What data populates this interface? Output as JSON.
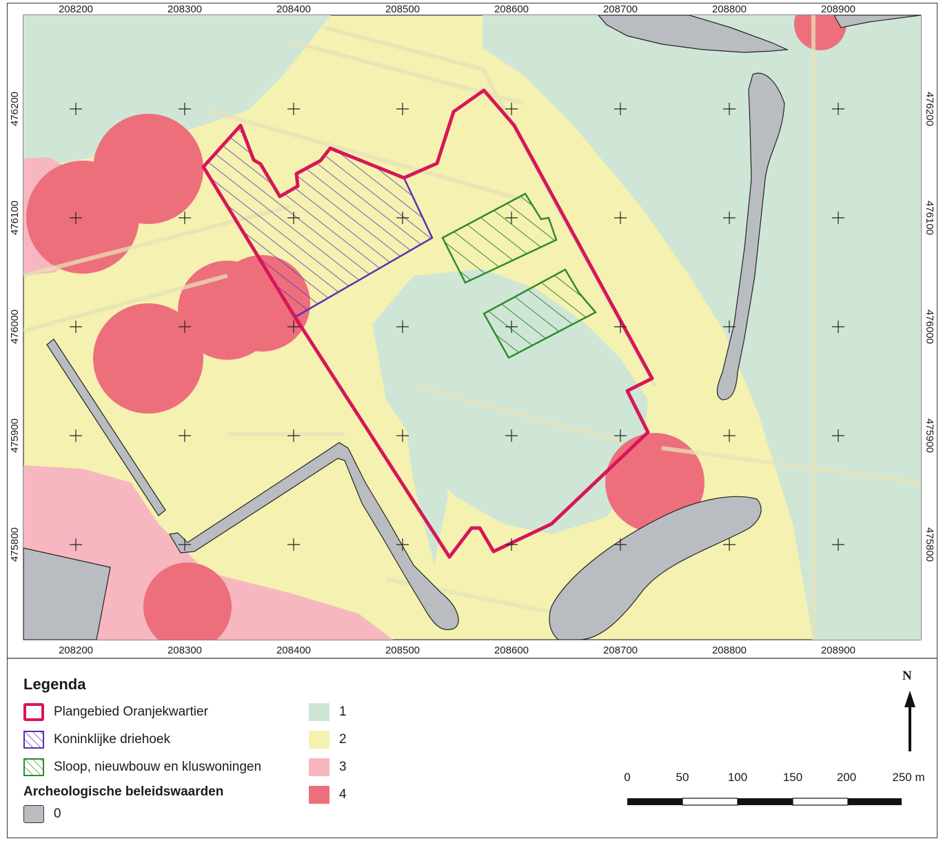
{
  "map": {
    "x_ticks_top": [
      "208200",
      "208300",
      "208400",
      "208500",
      "208600",
      "208700",
      "208800",
      "208900"
    ],
    "x_ticks_bottom": [
      "208200",
      "208300",
      "208400",
      "208500",
      "208600",
      "208700",
      "208800",
      "208900"
    ],
    "y_ticks_left": [
      "476200",
      "476100",
      "476000",
      "475900",
      "475800"
    ],
    "y_ticks_right": [
      "476200",
      "476100",
      "476000",
      "475900",
      "475800"
    ],
    "colors": {
      "waarde_0": "#b9bcc0",
      "waarde_1": "#cfe6d6",
      "waarde_2": "#f5f1b0",
      "waarde_3": "#f7b7c0",
      "waarde_4": "#ee6f7c",
      "plangebied": "#d6165a",
      "koninklijke": "#5a2fb0",
      "sloop": "#2f8a2f"
    }
  },
  "legend": {
    "title": "Legenda",
    "items_left": [
      {
        "label": "Plangebied Oranjekwartier",
        "icon": "plangebied-swatch"
      },
      {
        "label": "Koninklijke driehoek",
        "icon": "hatched-purple-swatch"
      },
      {
        "label": "Sloop, nieuwbouw en kluswoningen",
        "icon": "hatched-green-swatch"
      }
    ],
    "subtitle": "Archeologische beleidswaarden",
    "value_0": "0",
    "values_right": [
      "1",
      "2",
      "3",
      "4"
    ]
  },
  "scalebar": {
    "labels": [
      "0",
      "50",
      "100",
      "150",
      "200",
      "250 m"
    ]
  },
  "north": {
    "label": "N",
    "icon": "north-arrow-icon"
  }
}
